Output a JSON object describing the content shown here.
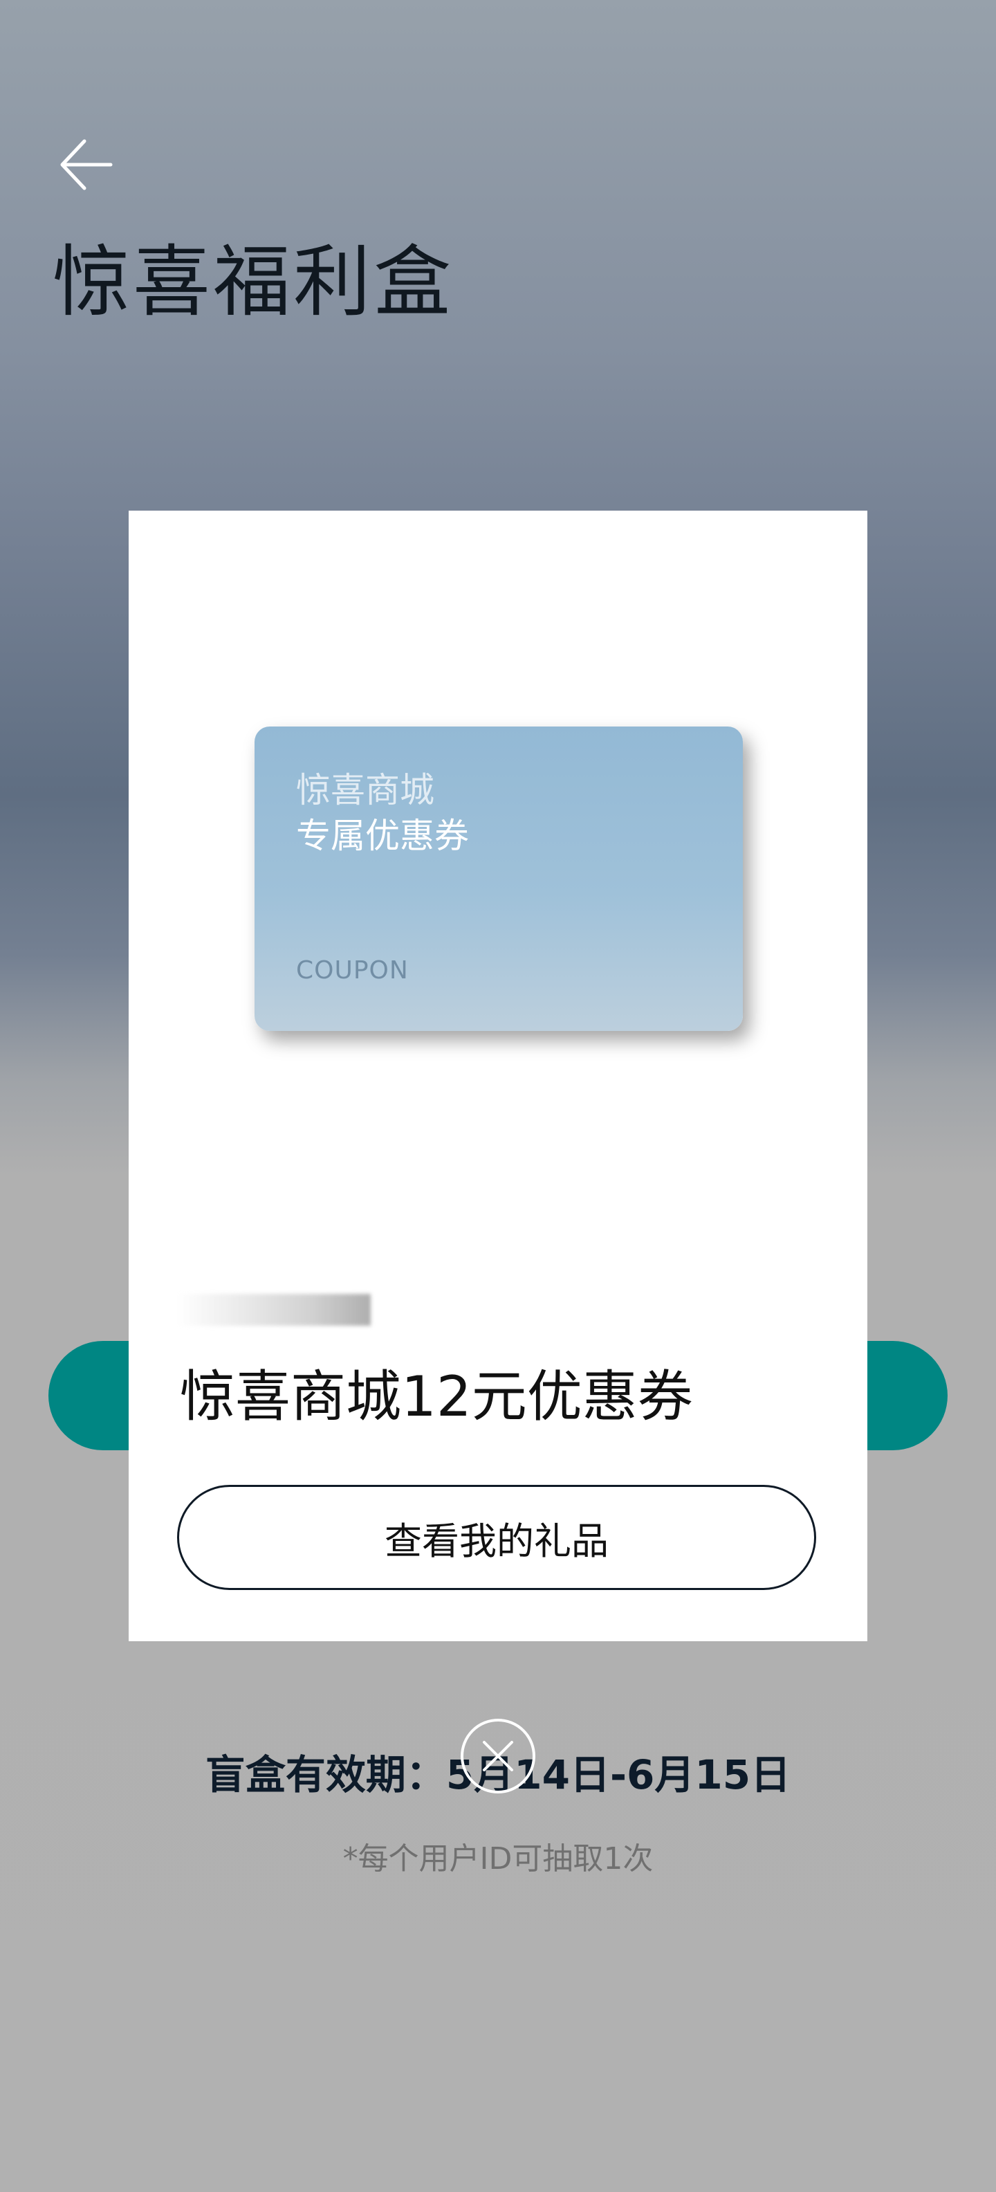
{
  "header": {
    "back_icon": "arrow-left-icon",
    "title": "惊喜福利盒"
  },
  "page": {
    "validity_text": "盲盒有效期：5月14日-6月15日",
    "note_text": "*每个用户ID可抽取1次",
    "accent_color": "#008683"
  },
  "modal": {
    "coupon_card": {
      "line1": "惊喜商城",
      "line2": "专属优惠券",
      "label": "COUPON"
    },
    "gift_name": "惊喜商城12元优惠券",
    "view_button_label": "查看我的礼品",
    "close_icon": "close-circle-icon"
  }
}
